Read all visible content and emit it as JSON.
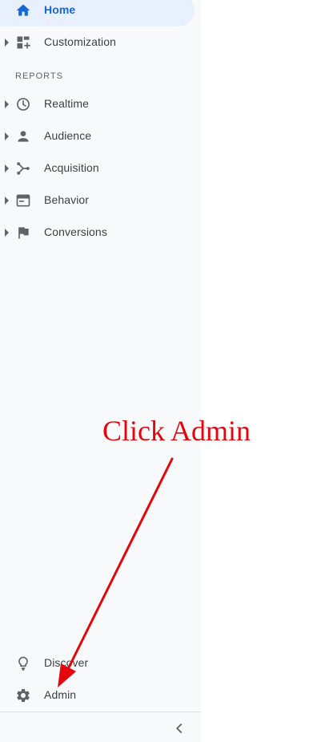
{
  "nav": {
    "home": {
      "label": "Home",
      "icon": "home-icon",
      "active": true
    },
    "customization": {
      "label": "Customization",
      "icon": "dashboard-icon"
    }
  },
  "reports": {
    "header": "REPORTS",
    "items": [
      {
        "label": "Realtime",
        "icon": "clock-icon"
      },
      {
        "label": "Audience",
        "icon": "person-icon"
      },
      {
        "label": "Acquisition",
        "icon": "merge-icon"
      },
      {
        "label": "Behavior",
        "icon": "web-icon"
      },
      {
        "label": "Conversions",
        "icon": "flag-icon"
      }
    ]
  },
  "footer": {
    "discover": {
      "label": "Discover",
      "icon": "lightbulb-icon"
    },
    "admin": {
      "label": "Admin",
      "icon": "gear-icon"
    },
    "collapse_icon": "chevron-left-icon"
  },
  "annotation": {
    "text": "Click Admin",
    "color": "#e5060d"
  },
  "colors": {
    "accent": "#1967d2",
    "active_bg": "#e8f0fe",
    "sidebar_bg": "#f8f9fa",
    "icon": "#5f6368",
    "text": "#3c4043"
  }
}
